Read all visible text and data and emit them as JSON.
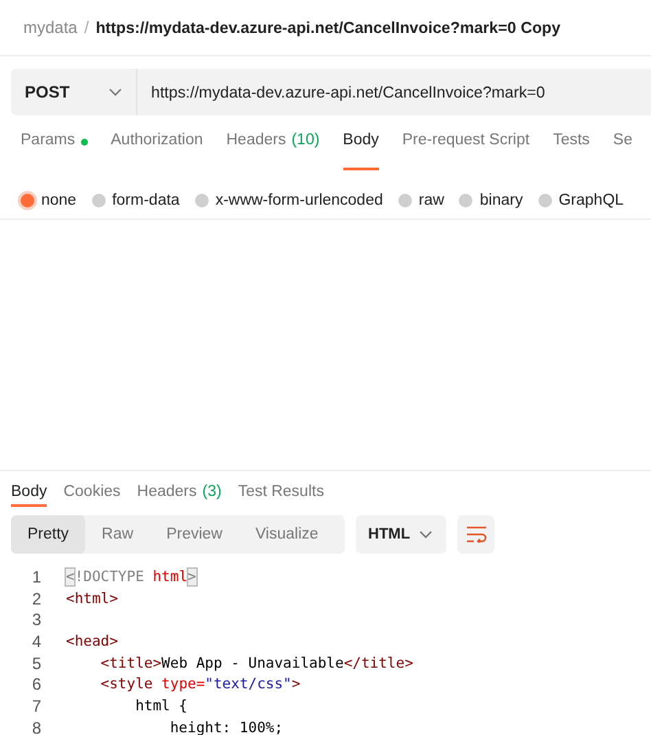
{
  "breadcrumb": {
    "collection": "mydata",
    "separator": "/",
    "request": "https://mydata-dev.azure-api.net/CancelInvoice?mark=0 Copy"
  },
  "request": {
    "method": "POST",
    "url": "https://mydata-dev.azure-api.net/CancelInvoice?mark=0"
  },
  "request_tabs": [
    {
      "label": "Params",
      "dot": true,
      "selected": false
    },
    {
      "label": "Authorization",
      "dot": false,
      "selected": false
    },
    {
      "label": "Headers",
      "count": "(10)",
      "dot": false,
      "selected": false
    },
    {
      "label": "Body",
      "dot": false,
      "selected": true
    },
    {
      "label": "Pre-request Script",
      "dot": false,
      "selected": false
    },
    {
      "label": "Tests",
      "dot": false,
      "selected": false
    },
    {
      "label": "Se",
      "dot": false,
      "selected": false
    }
  ],
  "body_types": [
    {
      "label": "none",
      "selected": true
    },
    {
      "label": "form-data",
      "selected": false
    },
    {
      "label": "x-www-form-urlencoded",
      "selected": false
    },
    {
      "label": "raw",
      "selected": false
    },
    {
      "label": "binary",
      "selected": false
    },
    {
      "label": "GraphQL",
      "selected": false
    }
  ],
  "response_tabs": [
    {
      "label": "Body",
      "selected": true
    },
    {
      "label": "Cookies",
      "selected": false
    },
    {
      "label": "Headers",
      "count": "(3)",
      "selected": false
    },
    {
      "label": "Test Results",
      "selected": false
    }
  ],
  "view_modes": [
    {
      "label": "Pretty",
      "selected": true
    },
    {
      "label": "Raw",
      "selected": false
    },
    {
      "label": "Preview",
      "selected": false
    },
    {
      "label": "Visualize",
      "selected": false
    }
  ],
  "format": "HTML",
  "code_lines": [
    {
      "number": "1",
      "tokens": [
        {
          "text": "<",
          "kind": "match"
        },
        {
          "text": "!DOCTYPE ",
          "kind": "doctype"
        },
        {
          "text": "html",
          "kind": "attr"
        },
        {
          "text": ">",
          "kind": "match"
        }
      ]
    },
    {
      "number": "2",
      "tokens": [
        {
          "text": "<html>",
          "kind": "tag"
        }
      ]
    },
    {
      "number": "3"
    },
    {
      "number": "4",
      "tokens": [
        {
          "text": "<head>",
          "kind": "tag"
        }
      ]
    },
    {
      "number": "5",
      "tokens": [
        {
          "text": "    <title>",
          "kind": "tag"
        },
        {
          "text": "Web App - Unavailable",
          "kind": "plain"
        },
        {
          "text": "</title>",
          "kind": "tag"
        }
      ]
    },
    {
      "number": "6",
      "tokens": [
        {
          "text": "    <style ",
          "kind": "tag"
        },
        {
          "text": "type=",
          "kind": "attr"
        },
        {
          "text": "\"text/css\"",
          "kind": "string"
        },
        {
          "text": ">",
          "kind": "tag"
        }
      ]
    },
    {
      "number": "7",
      "tokens": [
        {
          "text": "        html {",
          "kind": "plain"
        }
      ]
    },
    {
      "number": "8",
      "tokens": [
        {
          "text": "            height: 100%;",
          "kind": "plain"
        }
      ]
    }
  ]
}
